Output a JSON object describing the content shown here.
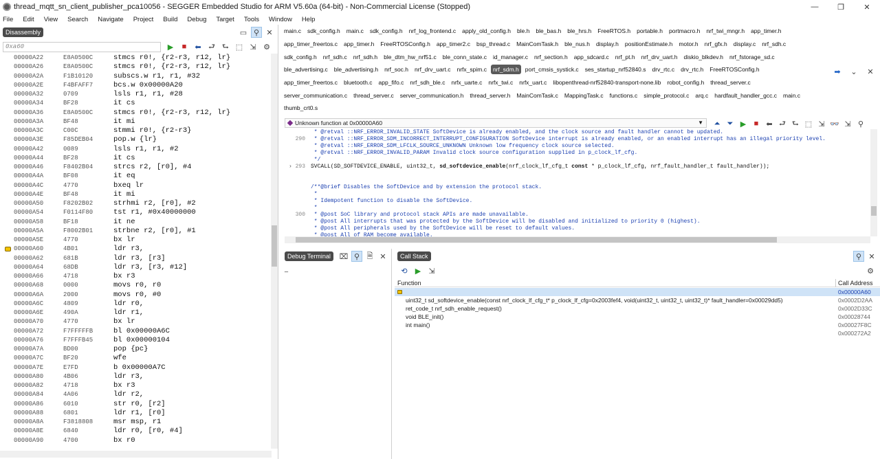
{
  "window": {
    "title": "thread_mqtt_sn_client_publisher_pca10056 - SEGGER Embedded Studio for ARM V5.60a (64-bit) - Non-Commercial License (Stopped)",
    "minimize": "—",
    "maximize": "❐",
    "close": "✕"
  },
  "menu": [
    "File",
    "Edit",
    "View",
    "Search",
    "Navigate",
    "Project",
    "Build",
    "Debug",
    "Target",
    "Tools",
    "Window",
    "Help"
  ],
  "disassembly": {
    "title": "Disassembly",
    "address_placeholder": "0xa60",
    "rows": [
      [
        "00000A22",
        "E8A0500C",
        "stmcs r0!, {r2-r3, r12, lr}"
      ],
      [
        "00000A26",
        "E8A0500C",
        "stmcs r0!, {r2-r3, r12, lr}"
      ],
      [
        "00000A2A",
        "F1B10120",
        "subscs.w r1, r1, #32"
      ],
      [
        "00000A2E",
        "F4BFAFF7",
        "bcs.w 0x00000A20"
      ],
      [
        "00000A32",
        "0709",
        "lsls r1, r1, #28"
      ],
      [
        "00000A34",
        "BF28",
        "it cs"
      ],
      [
        "00000A36",
        "E8A0500C",
        "stmcs r0!, {r2-r3, r12, lr}"
      ],
      [
        "00000A3A",
        "BF48",
        "it mi"
      ],
      [
        "00000A3C",
        "C00C",
        "stmmi r0!, {r2-r3}"
      ],
      [
        "00000A3E",
        "F85DEB04",
        "pop.w {lr}"
      ],
      [
        "00000A42",
        "0089",
        "lsls r1, r1, #2"
      ],
      [
        "00000A44",
        "BF28",
        "it cs"
      ],
      [
        "00000A46",
        "F8402B04",
        "strcs r2, [r0], #4"
      ],
      [
        "00000A4A",
        "BF08",
        "it eq"
      ],
      [
        "00000A4C",
        "4770",
        "bxeq lr"
      ],
      [
        "00000A4E",
        "BF48",
        "it mi"
      ],
      [
        "00000A50",
        "F8202B02",
        "strhmi r2, [r0], #2"
      ],
      [
        "00000A54",
        "F0114F80",
        "tst r1, #0x40000000"
      ],
      [
        "00000A58",
        "BF18",
        "it ne"
      ],
      [
        "00000A5A",
        "F8002B01",
        "strbne r2, [r0], #1"
      ],
      [
        "00000A5E",
        "4770",
        "bx lr"
      ],
      [
        "00000A60",
        "4B01",
        "ldr r3,"
      ],
      [
        "00000A62",
        "681B",
        "ldr r3, [r3]"
      ],
      [
        "00000A64",
        "68DB",
        "ldr r3, [r3, #12]"
      ],
      [
        "00000A66",
        "4718",
        "bx r3"
      ],
      [
        "00000A68",
        "0000",
        "movs r0, r0"
      ],
      [
        "00000A6A",
        "2000",
        "movs r0, #0"
      ],
      [
        "00000A6C",
        "4809",
        "ldr r0,"
      ],
      [
        "00000A6E",
        "490A",
        "ldr r1,"
      ],
      [
        "00000A70",
        "4770",
        "bx lr"
      ],
      [
        "00000A72",
        "F7FFFFFB",
        "bl 0x00000A6C"
      ],
      [
        "00000A76",
        "F7FFFB45",
        "bl 0x00000104"
      ],
      [
        "00000A7A",
        "BD00",
        "pop {pc}"
      ],
      [
        "00000A7C",
        "BF20",
        "wfe"
      ],
      [
        "00000A7E",
        "E7FD",
        "b 0x00000A7C"
      ],
      [
        "00000A80",
        "4B06",
        "ldr r3,"
      ],
      [
        "00000A82",
        "4718",
        "bx r3"
      ],
      [
        "00000A84",
        "4A06",
        "ldr r2,"
      ],
      [
        "00000A86",
        "6010",
        "str r0, [r2]"
      ],
      [
        "00000A88",
        "6801",
        "ldr r1, [r0]"
      ],
      [
        "00000A8A",
        "F3818808",
        "msr msp, r1"
      ],
      [
        "00000A8E",
        "6840",
        "ldr r0, [r0, #4]"
      ],
      [
        "00000A90",
        "4700",
        "bx r0"
      ]
    ]
  },
  "editor": {
    "tab_lines": [
      [
        "main.c",
        "sdk_config.h",
        "main.c",
        "sdk_config.h",
        "nrf_log_frontend.c",
        "apply_old_config.h",
        "ble.h",
        "ble_bas.h",
        "ble_hrs.h",
        "FreeRTOS.h",
        "portable.h",
        "portmacro.h",
        "nrf_twi_mngr.h",
        "app_timer.h"
      ],
      [
        "app_timer_freertos.c",
        "app_timer.h",
        "FreeRTOSConfig.h",
        "app_timer2.c",
        "bsp_thread.c",
        "MainComTask.h",
        "ble_nus.h",
        "display.h",
        "positionEstimate.h",
        "motor.h",
        "nrf_gfx.h",
        "display.c",
        "nrf_sdh.c"
      ],
      [
        "sdk_config.h",
        "nrf_sdh.c",
        "nrf_sdh.h",
        "ble_dtm_hw_nrf51.c",
        "ble_conn_state.c",
        "id_manager.c",
        "nrf_section.h",
        "app_sdcard.c",
        "nrf_pt.h",
        "nrf_drv_uart.h",
        "diskio_blkdev.h",
        "nrf_fstorage_sd.c"
      ],
      [
        "ble_advertising.c",
        "ble_advertising.h",
        "nrf_soc.h",
        "nrf_drv_uart.c",
        "nrfx_spim.c",
        "nrf_sdm.h",
        "port_cmsis_systick.c",
        "ses_startup_nrf52840.s",
        "drv_rtc.c",
        "drv_rtc.h",
        "FreeRTOSConfig.h"
      ],
      [
        "app_timer_freertos.c",
        "bluetooth.c",
        "app_fifo.c",
        "nrf_sdh_ble.c",
        "nrfx_uarte.c",
        "nrfx_twi.c",
        "nrfx_uart.c",
        "libopenthread-nrf52840-transport-none.lib",
        "robot_config.h",
        "thread_server.c"
      ],
      [
        "server_communication.c",
        "thread_server.c",
        "server_communication.h",
        "thread_server.h",
        "MainComTask.c",
        "MappingTask.c",
        "functions.c",
        "simple_protocol.c",
        "arq.c",
        "hardfault_handler_gcc.c",
        "main.c"
      ],
      [
        "thumb_crt0.s"
      ]
    ],
    "active_tab": "nrf_sdm.h",
    "function_bar": "Unknown function at 0x00000A60",
    "code_lines": [
      {
        "ln": "",
        "text": " * @retval ::NRF_ERROR_INVALID_STATE SoftDevice is already enabled, and the clock source and fault handler cannot be updated.",
        "cls": "cmt"
      },
      {
        "ln": "290",
        "text": " * @retval ::NRF_ERROR_SDM_INCORRECT_INTERRUPT_CONFIGURATION SoftDevice interrupt is already enabled, or an enabled interrupt has an illegal priority level.",
        "cls": "cmt"
      },
      {
        "ln": "",
        "text": " * @retval ::NRF_ERROR_SDM_LFCLK_SOURCE_UNKNOWN Unknown low frequency clock source selected.",
        "cls": "cmt"
      },
      {
        "ln": "",
        "text": " * @retval ::NRF_ERROR_INVALID_PARAM Invalid clock source configuration supplied in p_clock_lf_cfg.",
        "cls": "cmt"
      },
      {
        "ln": "",
        "text": " */",
        "cls": "cmt"
      },
      {
        "ln": "293",
        "text": "SVCALL(SD_SOFTDEVICE_ENABLE, uint32_t, sd_softdevice_enable(nrf_clock_lf_cfg_t const * p_clock_lf_cfg, nrf_fault_handler_t fault_handler));",
        "cls": "sig"
      },
      {
        "ln": "",
        "text": "",
        "cls": "cmt"
      },
      {
        "ln": "",
        "text": "",
        "cls": "cmt"
      },
      {
        "ln": "",
        "text": "/**@brief Disables the SoftDevice and by extension the protocol stack.",
        "cls": "cmt"
      },
      {
        "ln": "",
        "text": " *",
        "cls": "cmt"
      },
      {
        "ln": "",
        "text": " * Idempotent function to disable the SoftDevice.",
        "cls": "cmt"
      },
      {
        "ln": "",
        "text": " *",
        "cls": "cmt"
      },
      {
        "ln": "300",
        "text": " * @post SoC library and protocol stack APIs are made unavailable.",
        "cls": "cmt"
      },
      {
        "ln": "",
        "text": " * @post All interrupts that was protected by the SoftDevice will be disabled and initialized to priority 0 (highest).",
        "cls": "cmt"
      },
      {
        "ln": "",
        "text": " * @post All peripherals used by the SoftDevice will be reset to default values.",
        "cls": "cmt"
      },
      {
        "ln": "",
        "text": " * @post All of RAM become available.",
        "cls": "cmt"
      }
    ]
  },
  "debug_terminal": {
    "title": "Debug Terminal",
    "content": "_"
  },
  "call_stack": {
    "title": "Call Stack",
    "col_function": "Function",
    "col_address": "Call Address",
    "rows": [
      {
        "fn": "",
        "addr": "0x00000A60"
      },
      {
        "fn": "uint32_t sd_softdevice_enable(const nrf_clock_lf_cfg_t* p_clock_lf_cfg=0x2003fef4, void(uint32_t, uint32_t, uint32_t)* fault_handler=0x00029dd5)",
        "addr": "0x0002D2AA"
      },
      {
        "fn": "ret_code_t nrf_sdh_enable_request()",
        "addr": "0x0002D33C"
      },
      {
        "fn": "void BLE_init()",
        "addr": "0x00028744"
      },
      {
        "fn": "int main()",
        "addr": "0x00027F8C"
      },
      {
        "fn": "",
        "addr": "0x000272A2"
      }
    ]
  }
}
